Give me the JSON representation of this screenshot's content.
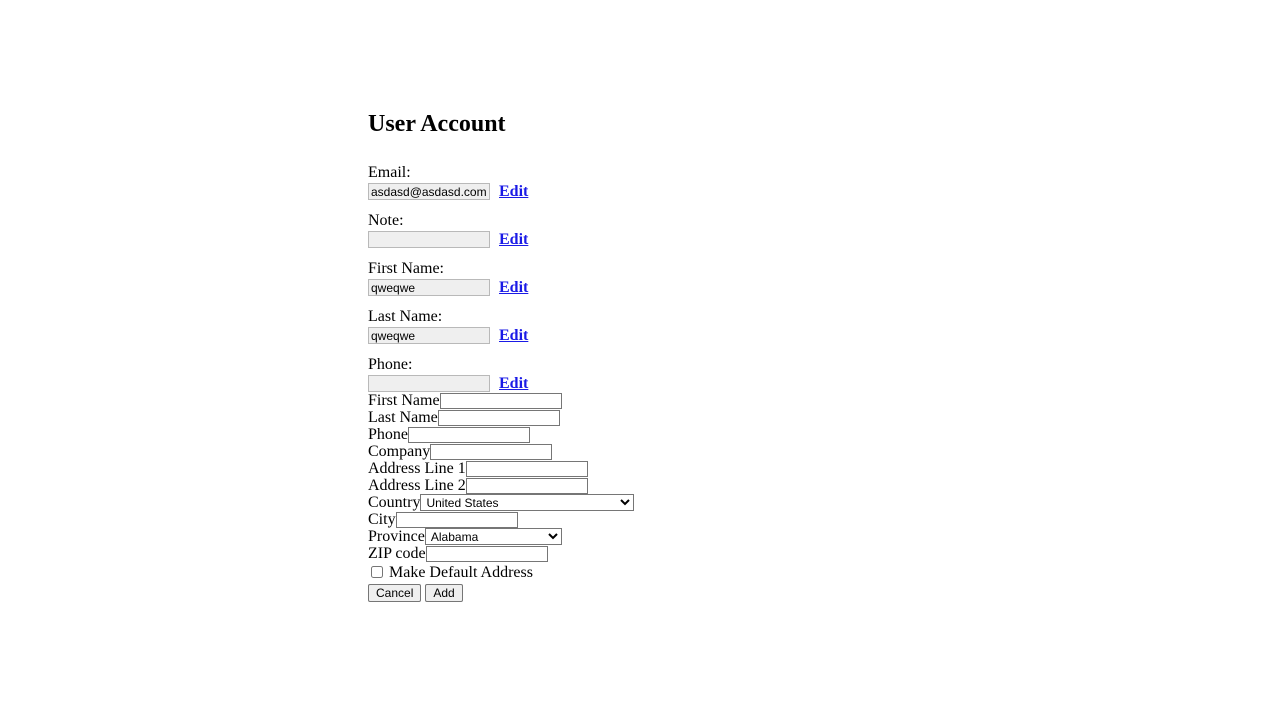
{
  "page": {
    "title": "User Account"
  },
  "account": {
    "edit_label": "Edit",
    "fields": [
      {
        "label": "Email:",
        "value": "asdasd@asdasd.com",
        "name": "email"
      },
      {
        "label": "Note:",
        "value": "",
        "name": "note"
      },
      {
        "label": "First Name:",
        "value": "qweqwe",
        "name": "first-name"
      },
      {
        "label": "Last Name:",
        "value": "qweqwe",
        "name": "last-name"
      },
      {
        "label": "Phone:",
        "value": "",
        "name": "phone"
      }
    ]
  },
  "address_form": {
    "rows": [
      {
        "label": "First Name",
        "value": "",
        "name": "first-name"
      },
      {
        "label": "Last Name",
        "value": "",
        "name": "last-name"
      },
      {
        "label": "Phone",
        "value": "",
        "name": "phone"
      },
      {
        "label": "Company",
        "value": "",
        "name": "company"
      },
      {
        "label": "Address Line 1",
        "value": "",
        "name": "address-line-1"
      },
      {
        "label": "Address Line 2",
        "value": "",
        "name": "address-line-2"
      }
    ],
    "country": {
      "label": "Country",
      "selected": "United States",
      "options": [
        "United States"
      ]
    },
    "city": {
      "label": "City",
      "value": ""
    },
    "province": {
      "label": "Province",
      "selected": "Alabama",
      "options": [
        "Alabama"
      ]
    },
    "zip": {
      "label": "ZIP code",
      "value": ""
    },
    "make_default": {
      "label": "Make Default Address",
      "checked": false
    },
    "buttons": {
      "cancel": "Cancel",
      "add": "Add"
    }
  }
}
